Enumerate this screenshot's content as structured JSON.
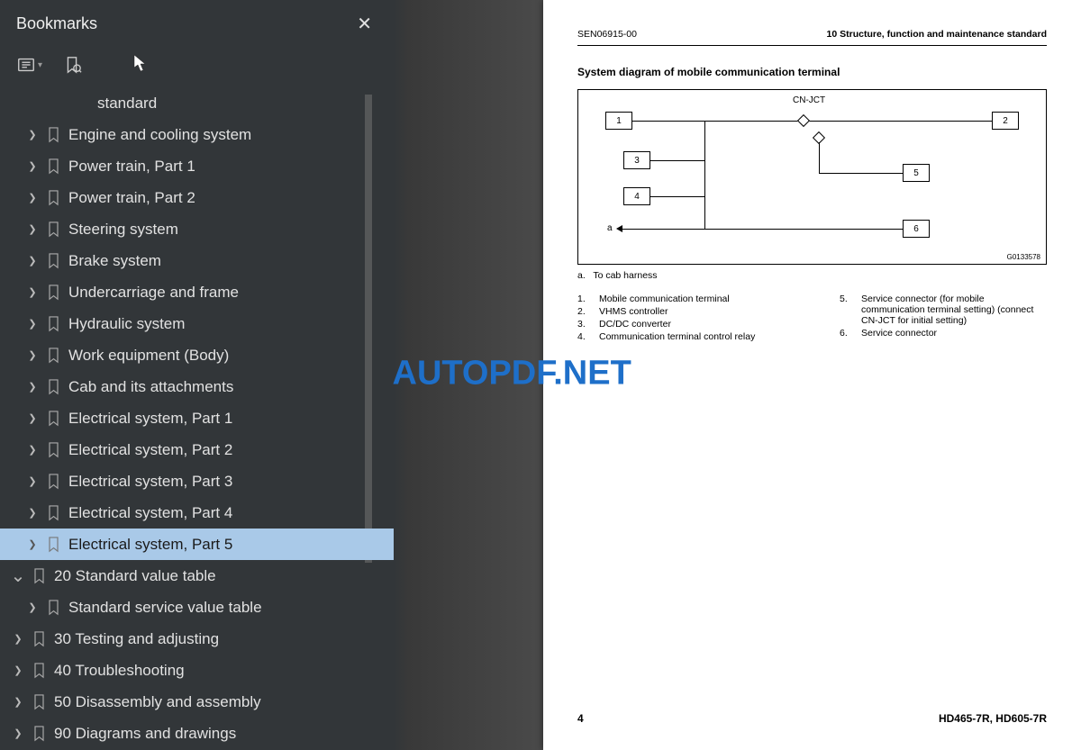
{
  "sidebar": {
    "title": "Bookmarks",
    "items": [
      {
        "label": "standard",
        "indent": 2,
        "chevron": "",
        "ribbon": false,
        "selected": false
      },
      {
        "label": "Engine and cooling system",
        "indent": 1,
        "chevron": ">",
        "ribbon": true,
        "selected": false
      },
      {
        "label": "Power train, Part 1",
        "indent": 1,
        "chevron": ">",
        "ribbon": true,
        "selected": false
      },
      {
        "label": "Power train, Part 2",
        "indent": 1,
        "chevron": ">",
        "ribbon": true,
        "selected": false
      },
      {
        "label": "Steering system",
        "indent": 1,
        "chevron": ">",
        "ribbon": true,
        "selected": false
      },
      {
        "label": "Brake system",
        "indent": 1,
        "chevron": ">",
        "ribbon": true,
        "selected": false
      },
      {
        "label": "Undercarriage and frame",
        "indent": 1,
        "chevron": ">",
        "ribbon": true,
        "selected": false
      },
      {
        "label": "Hydraulic system",
        "indent": 1,
        "chevron": ">",
        "ribbon": true,
        "selected": false
      },
      {
        "label": "Work equipment (Body)",
        "indent": 1,
        "chevron": ">",
        "ribbon": true,
        "selected": false
      },
      {
        "label": "Cab and its attachments",
        "indent": 1,
        "chevron": ">",
        "ribbon": true,
        "selected": false
      },
      {
        "label": "Electrical system, Part 1",
        "indent": 1,
        "chevron": ">",
        "ribbon": true,
        "selected": false
      },
      {
        "label": "Electrical system, Part 2",
        "indent": 1,
        "chevron": ">",
        "ribbon": true,
        "selected": false
      },
      {
        "label": "Electrical system, Part 3",
        "indent": 1,
        "chevron": ">",
        "ribbon": true,
        "selected": false
      },
      {
        "label": "Electrical system, Part 4",
        "indent": 1,
        "chevron": ">",
        "ribbon": true,
        "selected": false
      },
      {
        "label": "Electrical system, Part 5",
        "indent": 1,
        "chevron": ">",
        "ribbon": true,
        "selected": true
      },
      {
        "label": "20 Standard value table",
        "indent": 0,
        "chevron": "v",
        "ribbon": true,
        "selected": false
      },
      {
        "label": "Standard service value table",
        "indent": 1,
        "chevron": ">",
        "ribbon": true,
        "selected": false
      },
      {
        "label": "30 Testing and adjusting",
        "indent": 0,
        "chevron": ">",
        "ribbon": true,
        "selected": false
      },
      {
        "label": "40 Troubleshooting",
        "indent": 0,
        "chevron": ">",
        "ribbon": true,
        "selected": false
      },
      {
        "label": "50 Disassembly and assembly",
        "indent": 0,
        "chevron": ">",
        "ribbon": true,
        "selected": false
      },
      {
        "label": "90 Diagrams and drawings",
        "indent": 0,
        "chevron": ">",
        "ribbon": true,
        "selected": false
      }
    ]
  },
  "watermark": "AUTOPDF.NET",
  "doc": {
    "header_left": "SEN06915-00",
    "header_right": "10 Structure, function and maintenance standard",
    "section_title": "System diagram of mobile communication terminal",
    "diagram": {
      "connector_label": "CN-JCT",
      "note_a_label": "a",
      "diagram_id": "G0133578",
      "boxes": {
        "b1": "1",
        "b2": "2",
        "b3": "3",
        "b4": "4",
        "b5": "5",
        "b6": "6"
      }
    },
    "notes": {
      "a_num": "a.",
      "a_text": "To cab harness"
    },
    "legend_left": [
      {
        "num": "1.",
        "text": "Mobile communication terminal"
      },
      {
        "num": "2.",
        "text": "VHMS controller"
      },
      {
        "num": "3.",
        "text": "DC/DC converter"
      },
      {
        "num": "4.",
        "text": "Communication terminal control relay"
      }
    ],
    "legend_right": [
      {
        "num": "5.",
        "text": "Service connector (for mobile communication terminal setting) (connect CN-JCT for initial setting)"
      },
      {
        "num": "6.",
        "text": "Service connector"
      }
    ],
    "footer": {
      "page_num": "4",
      "models": "HD465-7R, HD605-7R"
    }
  }
}
